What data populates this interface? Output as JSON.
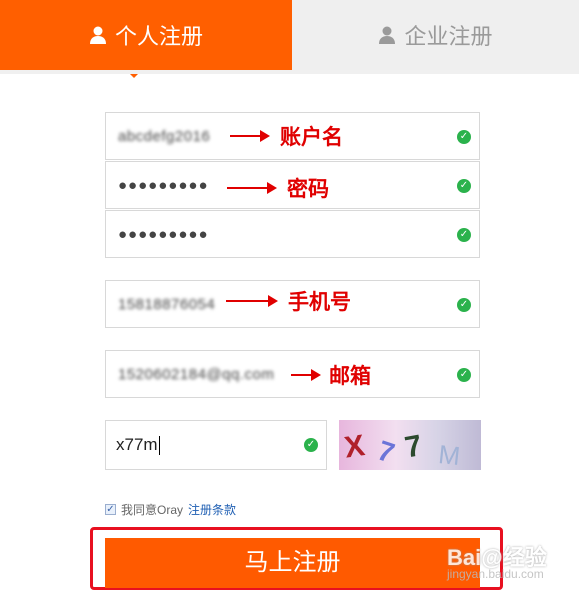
{
  "tabs": {
    "personal": "个人注册",
    "company": "企业注册"
  },
  "form": {
    "account": {
      "value": "abcdefg2016",
      "annotation": "账户名"
    },
    "password": {
      "value": "●●●●●●●●●",
      "annotation": "密码"
    },
    "password_confirm": {
      "value": "●●●●●●●●●"
    },
    "phone": {
      "value": "15818876054",
      "annotation": "手机号"
    },
    "email": {
      "value": "1520602184@qq.com",
      "annotation": "邮箱"
    },
    "captcha": {
      "value": "x77m",
      "image_text": [
        "X",
        "7",
        "7",
        "M"
      ]
    }
  },
  "agreement": {
    "text": "我同意Oray",
    "link": "注册条款",
    "checked": true
  },
  "submit_label": "马上注册",
  "watermark": {
    "brand": "Bai@经验",
    "site": "jingyan.baidu.com"
  },
  "colors": {
    "accent": "#ff5f00",
    "annotation": "#e00000",
    "check": "#2bb24c"
  }
}
